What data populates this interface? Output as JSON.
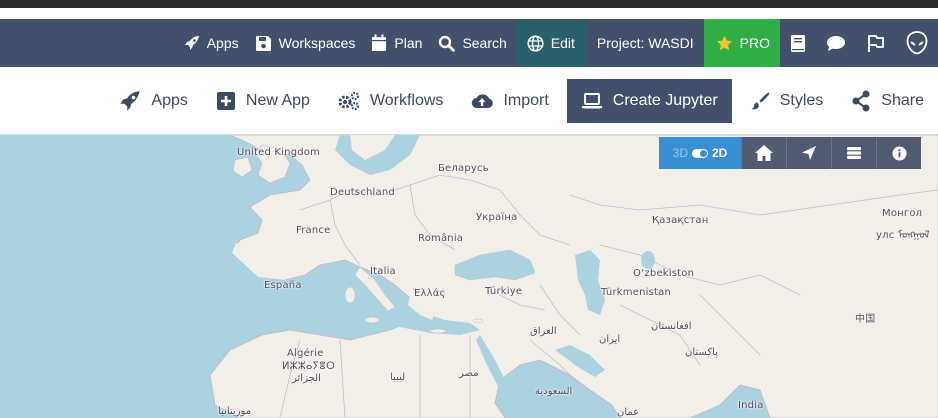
{
  "navbar": {
    "apps": "Apps",
    "workspaces": "Workspaces",
    "plan": "Plan",
    "search": "Search",
    "edit": "Edit",
    "project": "Project: WASDI",
    "pro": "PRO"
  },
  "toolbar": {
    "apps": "Apps",
    "new_app": "New App",
    "workflows": "Workflows",
    "import": "Import",
    "create_jupyter": "Create Jupyter",
    "styles": "Styles",
    "share": "Share"
  },
  "map_controls": {
    "mode_3d": "3D",
    "mode_2d": "2D"
  },
  "map_labels": {
    "united_kingdom": "United Kingdom",
    "deutschland": "Deutschland",
    "belarus": "Беларусь",
    "france": "France",
    "ukraina": "Україна",
    "kazakhstan": "Қазақстан",
    "mongol": "Монгол",
    "mongol2": "улс ᠮᠣᠩᠭᠣᠯ",
    "romania": "România",
    "italia": "Italia",
    "uzbekiston": "O‘zbekiston",
    "espana": "España",
    "ellas": "Ελλάς",
    "turkiye": "Türkiye",
    "turkmenistan": "Türkmenistan",
    "iraq": "العراق",
    "afghanistan": "افغانستان",
    "china": "中国",
    "iran": "ایران",
    "algerie": "Algérie",
    "algerie2": "ⵍⵣⵣⴰⵢⴻⵔ",
    "algerie3": "الجزائر",
    "libya": "ليبيا",
    "egypt": "مصر",
    "pakistan": "پاکستان",
    "saudi": "السعودية",
    "india": "India",
    "oman": "عمان",
    "mauritania": "موريتانيا"
  },
  "colors": {
    "navbar_bg": "#43506b",
    "edit_bg": "#2b5f6c",
    "pro_bg": "#2fae46",
    "active_btn_bg": "#43506b",
    "toggle_bg": "#3a8ed3",
    "sea": "#aad3df",
    "land": "#f2efe9"
  }
}
